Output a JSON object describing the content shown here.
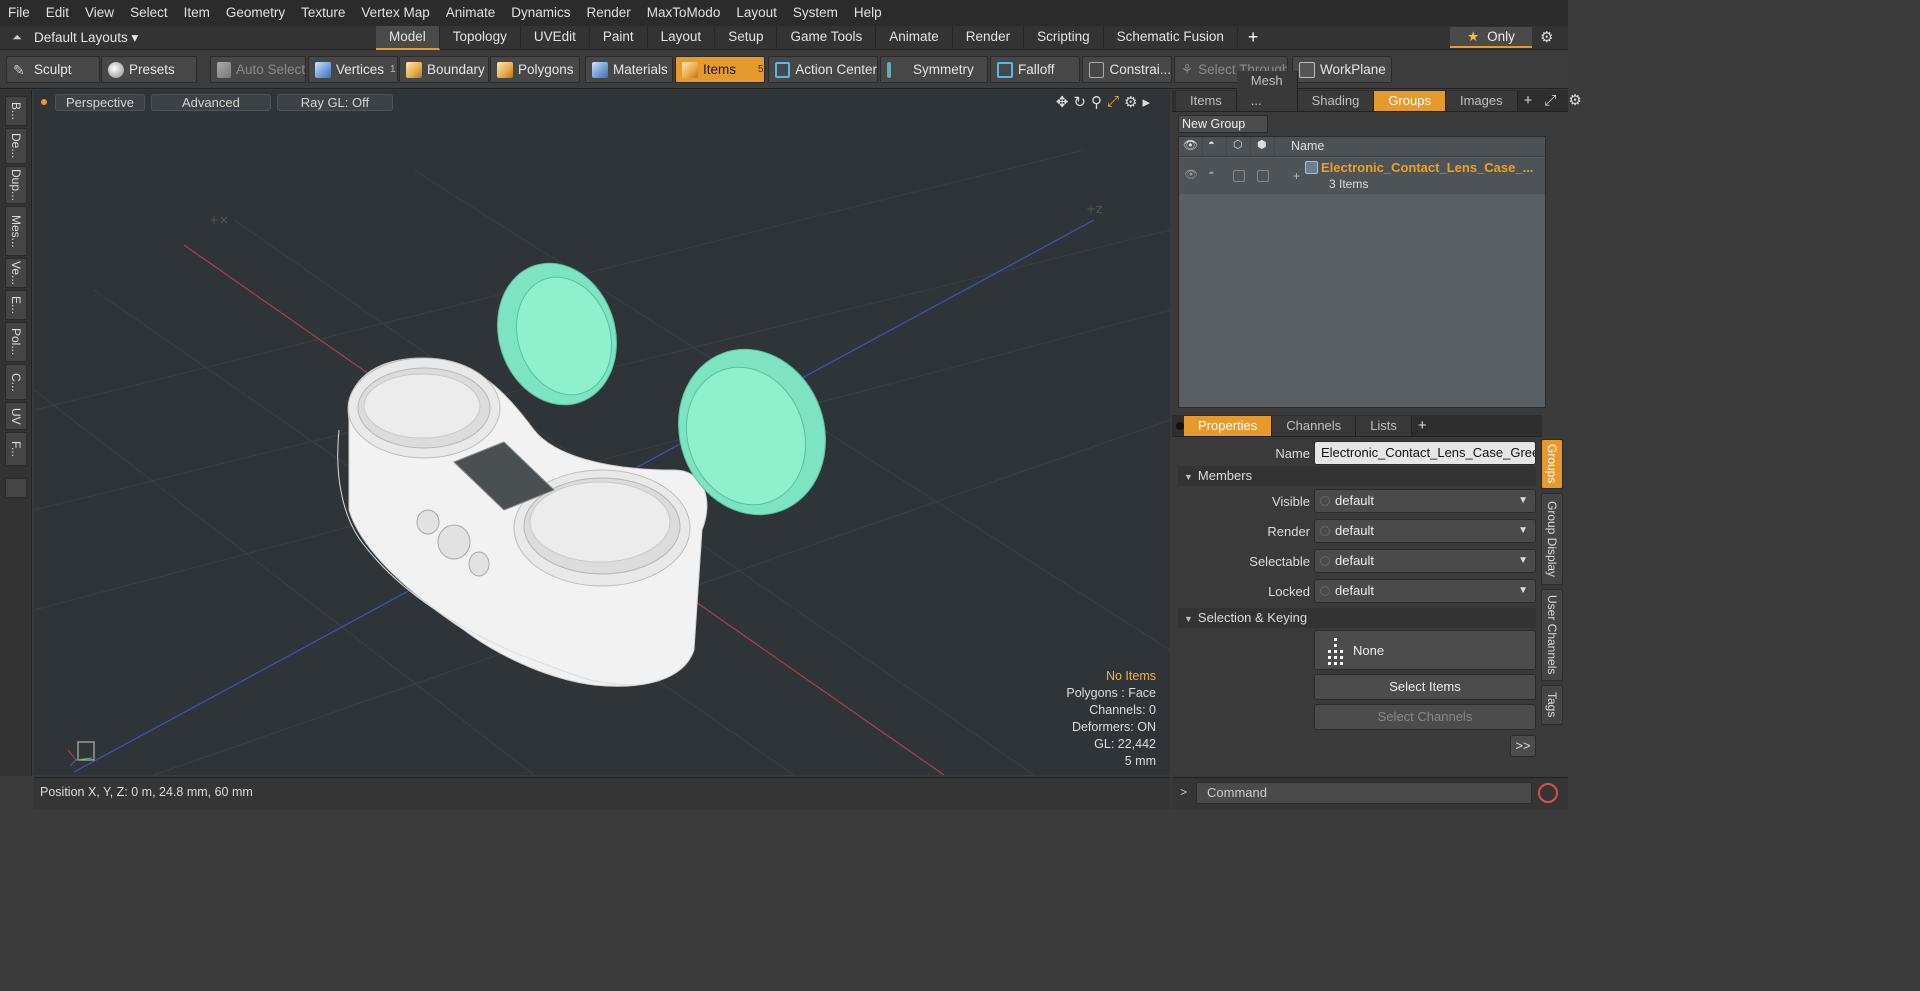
{
  "menu": [
    "File",
    "Edit",
    "View",
    "Select",
    "Item",
    "Geometry",
    "Texture",
    "Vertex Map",
    "Animate",
    "Dynamics",
    "Render",
    "MaxToModo",
    "Layout",
    "System",
    "Help"
  ],
  "layout_bar": {
    "layouts_label": "Default Layouts ▾",
    "tabs": [
      "Model",
      "Topology",
      "UVEdit",
      "Paint",
      "Layout",
      "Setup",
      "Game Tools",
      "Animate",
      "Render",
      "Scripting",
      "Schematic Fusion"
    ],
    "active_tab": "Model",
    "only_label": "Only"
  },
  "toolbar": {
    "sculpt": "Sculpt",
    "presets": "Presets",
    "auto_select": "Auto Select",
    "vertices": "Vertices",
    "vertices_count": "1",
    "boundary": "Boundary",
    "polygons": "Polygons",
    "materials": "Materials",
    "items": "Items",
    "items_count": "5",
    "action_center": "Action Center",
    "symmetry": "Symmetry",
    "falloff": "Falloff",
    "constraints": "Constrai...",
    "select_through": "Select Through",
    "workplane": "WorkPlane"
  },
  "left_tabs": [
    "B...",
    "De...",
    "Dup...",
    "Mes...",
    "Ve...",
    "E...",
    "Pol...",
    "C...",
    "UV",
    "F..."
  ],
  "viewport": {
    "perspective": "Perspective",
    "advanced": "Advanced",
    "raygl": "Ray GL: Off",
    "stats": {
      "items": "No Items",
      "polygons": "Polygons : Face",
      "channels": "Channels: 0",
      "deformers": "Deformers: ON",
      "gl": "GL: 22,442",
      "scale": "5 mm"
    }
  },
  "statusbar": {
    "position": "Position X, Y, Z:   0 m, 24.8 mm, 60 mm"
  },
  "top_panel": {
    "tabs": [
      "Items",
      "Mesh ...",
      "Shading",
      "Groups",
      "Images"
    ],
    "active_tab": "Groups",
    "new_group": "New Group",
    "col_name": "Name",
    "group": {
      "name": "Electronic_Contact_Lens_Case_...",
      "count": "3 Items"
    }
  },
  "properties_panel": {
    "tabs": [
      "Properties",
      "Channels",
      "Lists"
    ],
    "active_tab": "Properties",
    "name_label": "Name",
    "name_value": "Electronic_Contact_Lens_Case_Green",
    "members_section": "Members",
    "rows": [
      {
        "label": "Visible",
        "value": "default"
      },
      {
        "label": "Render",
        "value": "default"
      },
      {
        "label": "Selectable",
        "value": "default"
      },
      {
        "label": "Locked",
        "value": "default"
      }
    ],
    "selection_section": "Selection & Keying",
    "none_label": "None",
    "select_items": "Select Items",
    "select_channels": "Select Channels",
    "more": ">>",
    "side_tabs": [
      "Groups",
      "Group Display",
      "User Channels",
      "Tags"
    ]
  },
  "command": {
    "prompt": ">",
    "placeholder": "Command"
  },
  "colors": {
    "accent": "#e69a2c",
    "viewport_bg": "#2f3438",
    "cap_color": "#7de3c0",
    "body_color": "#f2f2f2",
    "group_name": "#f0a020"
  }
}
